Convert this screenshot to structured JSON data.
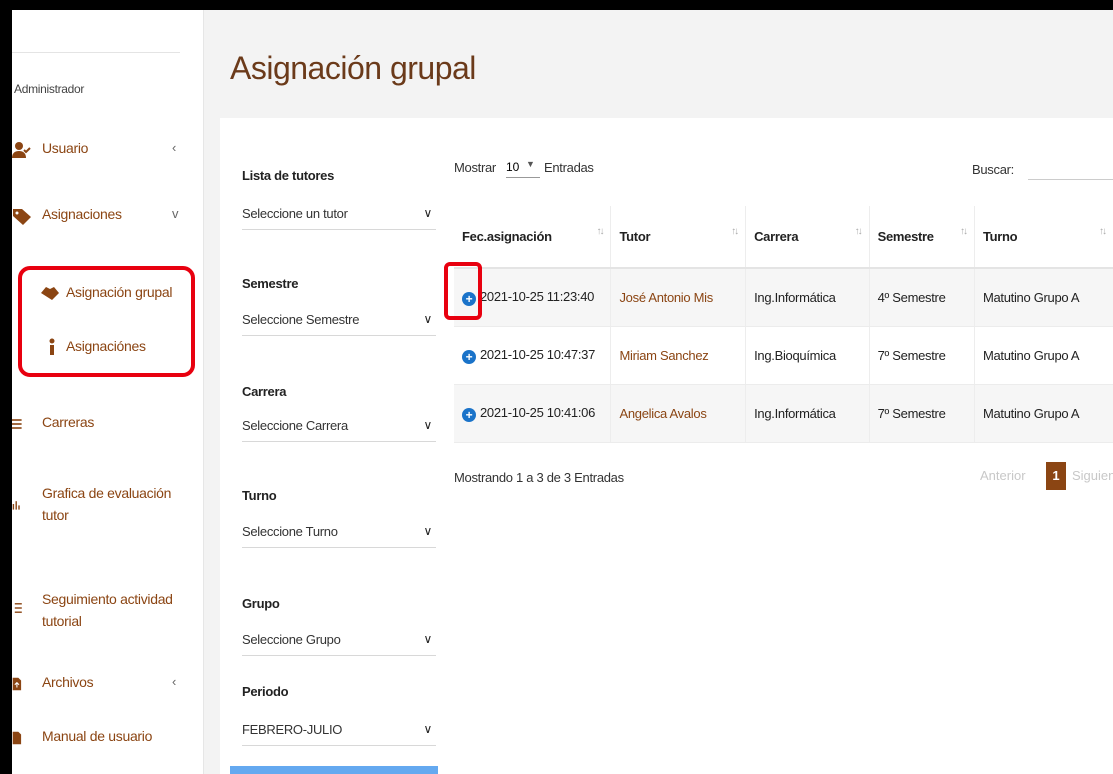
{
  "sidebar": {
    "role": "Administrador",
    "items": [
      {
        "label": "Usuario",
        "icon": "user-check-icon",
        "chevron": "‹"
      },
      {
        "label": "Asignaciones",
        "icon": "tag-icon",
        "chevron": "v"
      },
      {
        "label": "Carreras",
        "icon": "list-icon"
      },
      {
        "label": "Grafica de evaluación tutor",
        "icon": "bar-chart-icon"
      },
      {
        "label": "Seguimiento actividad tutorial",
        "icon": "checklist-icon"
      },
      {
        "label": "Archivos",
        "icon": "file-upload-icon",
        "chevron": "‹"
      },
      {
        "label": "Manual de usuario",
        "icon": "file-icon"
      }
    ],
    "subitems": [
      {
        "label": "Asignación grupal",
        "icon": "handshake-icon"
      },
      {
        "label": "Asignaciónes",
        "icon": "info-icon"
      }
    ]
  },
  "page": {
    "title": "Asignación grupal"
  },
  "filters": [
    {
      "label": "Lista de tutores",
      "value": "Seleccione un tutor"
    },
    {
      "label": "Semestre",
      "value": "Seleccione Semestre"
    },
    {
      "label": "Carrera",
      "value": "Seleccione Carrera"
    },
    {
      "label": "Turno",
      "value": "Seleccione Turno"
    },
    {
      "label": "Grupo",
      "value": "Seleccione Grupo"
    },
    {
      "label": "Periodo",
      "value": "FEBRERO-JULIO"
    }
  ],
  "table": {
    "show_prefix": "Mostrar",
    "show_value": "10",
    "show_suffix": "Entradas",
    "search_label": "Buscar:",
    "columns": [
      "Fec.asignación",
      "Tutor",
      "Carrera",
      "Semestre",
      "Turno"
    ],
    "rows": [
      [
        "2021-10-25 11:23:40",
        "José Antonio Mis",
        "Ing.Informática",
        "4º Semestre",
        "Matutino Grupo A"
      ],
      [
        "2021-10-25 10:47:37",
        "Miriam Sanchez",
        "Ing.Bioquímica",
        "7º Semestre",
        "Matutino Grupo A"
      ],
      [
        "2021-10-25 10:41:06",
        "Angelica Avalos",
        "Ing.Informática",
        "7º Semestre",
        "Matutino Grupo A"
      ]
    ],
    "info": "Mostrando 1 a 3 de 3 Entradas",
    "pager": {
      "prev": "Anterior",
      "current": "1",
      "next": "Siguiente"
    }
  },
  "colors": {
    "accent": "#8b4513",
    "highlight": "#e8000f",
    "link_blue": "#1a73c9"
  }
}
